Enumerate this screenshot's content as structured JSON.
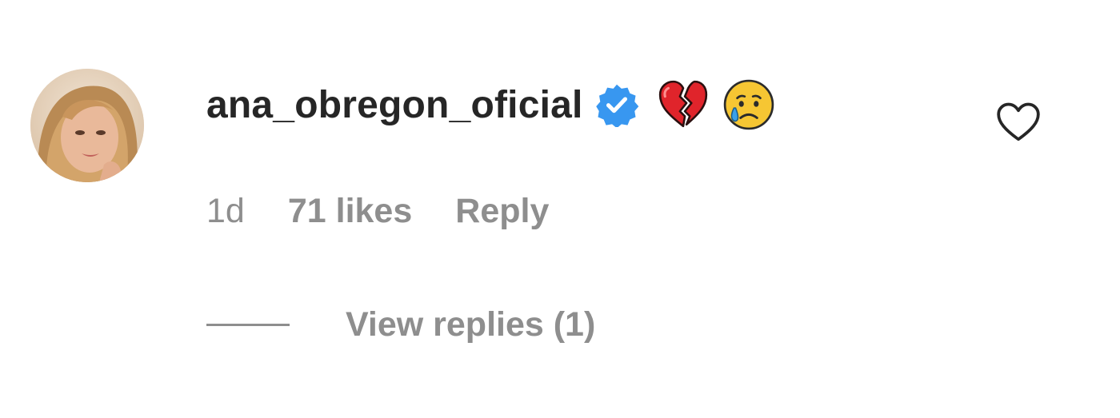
{
  "comment": {
    "username": "ana_obregon_oficial",
    "verified": true,
    "avatar_icon": "profile-photo",
    "reaction_emojis": [
      "broken-heart-emoji",
      "crying-face-emoji"
    ],
    "timestamp": "1d",
    "likes": "71 likes",
    "reply_label": "Reply",
    "view_replies_label": "View replies (1)",
    "like_icon": "heart-outline-icon"
  },
  "colors": {
    "text_primary": "#262626",
    "text_secondary": "#8e8e8e",
    "verified_blue": "#3897f0",
    "heart_red": "#e0242b"
  }
}
